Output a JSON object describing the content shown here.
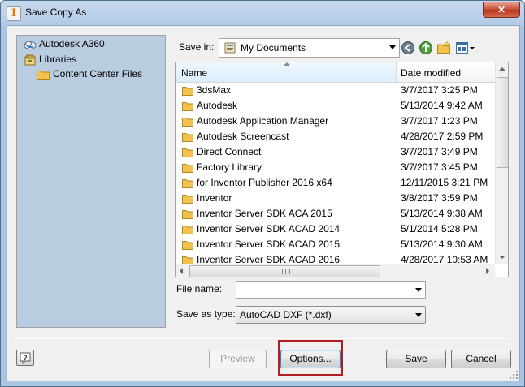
{
  "window": {
    "title": "Save Copy As",
    "close_label": "✕"
  },
  "places": [
    {
      "label": "Autodesk A360",
      "icon": "cloud-icon"
    },
    {
      "label": "Libraries",
      "icon": "libraries-icon"
    },
    {
      "label": "Content Center Files",
      "icon": "folder-icon"
    }
  ],
  "save_in": {
    "label": "Save in:",
    "value": "My Documents"
  },
  "columns": {
    "name": "Name",
    "date": "Date modified"
  },
  "files": [
    {
      "name": "3dsMax",
      "date": "3/7/2017 3:25 PM"
    },
    {
      "name": "Autodesk",
      "date": "5/13/2014 9:42 AM"
    },
    {
      "name": "Autodesk Application Manager",
      "date": "3/7/2017 1:23 PM"
    },
    {
      "name": "Autodesk Screencast",
      "date": "4/28/2017 2:59 PM"
    },
    {
      "name": "Direct Connect",
      "date": "3/7/2017 3:49 PM"
    },
    {
      "name": "Factory Library",
      "date": "3/7/2017 3:45 PM"
    },
    {
      "name": "for Inventor Publisher 2016 x64",
      "date": "12/11/2015 3:21 PM"
    },
    {
      "name": "Inventor",
      "date": "3/8/2017 3:59 PM"
    },
    {
      "name": "Inventor Server SDK ACA 2015",
      "date": "5/13/2014 9:38 AM"
    },
    {
      "name": "Inventor Server SDK ACAD 2014",
      "date": "5/1/2014 5:28 PM"
    },
    {
      "name": "Inventor Server SDK ACAD 2015",
      "date": "5/13/2014 9:30 AM"
    },
    {
      "name": "Inventor Server SDK ACAD 2016",
      "date": "4/28/2017 10:53 AM"
    }
  ],
  "file_name": {
    "label": "File name:",
    "value": ""
  },
  "save_as_type": {
    "label": "Save as type:",
    "value": "AutoCAD DXF (*.dxf)"
  },
  "buttons": {
    "preview": "Preview",
    "options": "Options...",
    "save": "Save",
    "cancel": "Cancel",
    "help": "?"
  },
  "colors": {
    "highlight": "#b01e23",
    "places_bg": "#b9cce0",
    "folder": "#f2c14e"
  }
}
